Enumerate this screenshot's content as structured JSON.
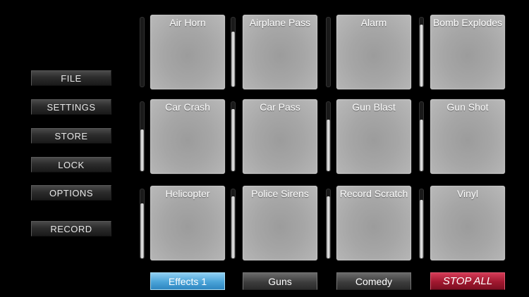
{
  "menu": {
    "file": "FILE",
    "settings": "SETTINGS",
    "store": "STORE",
    "lock": "LOCK",
    "options": "OPTIONS",
    "record": "RECORD"
  },
  "pads": [
    {
      "label": "Air Horn",
      "volume": 0.0
    },
    {
      "label": "Airplane Pass",
      "volume": 0.8
    },
    {
      "label": "Alarm",
      "volume": 0.0
    },
    {
      "label": "Bomb Explodes",
      "volume": 0.9
    },
    {
      "label": "Car Crash",
      "volume": 0.6
    },
    {
      "label": "Car Pass",
      "volume": 0.9
    },
    {
      "label": "Gun Blast",
      "volume": 0.75
    },
    {
      "label": "Gun Shot",
      "volume": 0.75
    },
    {
      "label": "Helicopter",
      "volume": 0.8
    },
    {
      "label": "Police Sirens",
      "volume": 0.9
    },
    {
      "label": "Record Scratch",
      "volume": 0.9
    },
    {
      "label": "Vinyl",
      "volume": 0.85
    }
  ],
  "banks": {
    "tab1": "Effects 1",
    "tab2": "Guns",
    "tab3": "Comedy",
    "active": "Effects 1"
  },
  "stop_all": "STOP ALL",
  "colors": {
    "active_tab": "#4aa3d8",
    "stop_all": "#a0182f",
    "pad": "#a6a6a6"
  }
}
